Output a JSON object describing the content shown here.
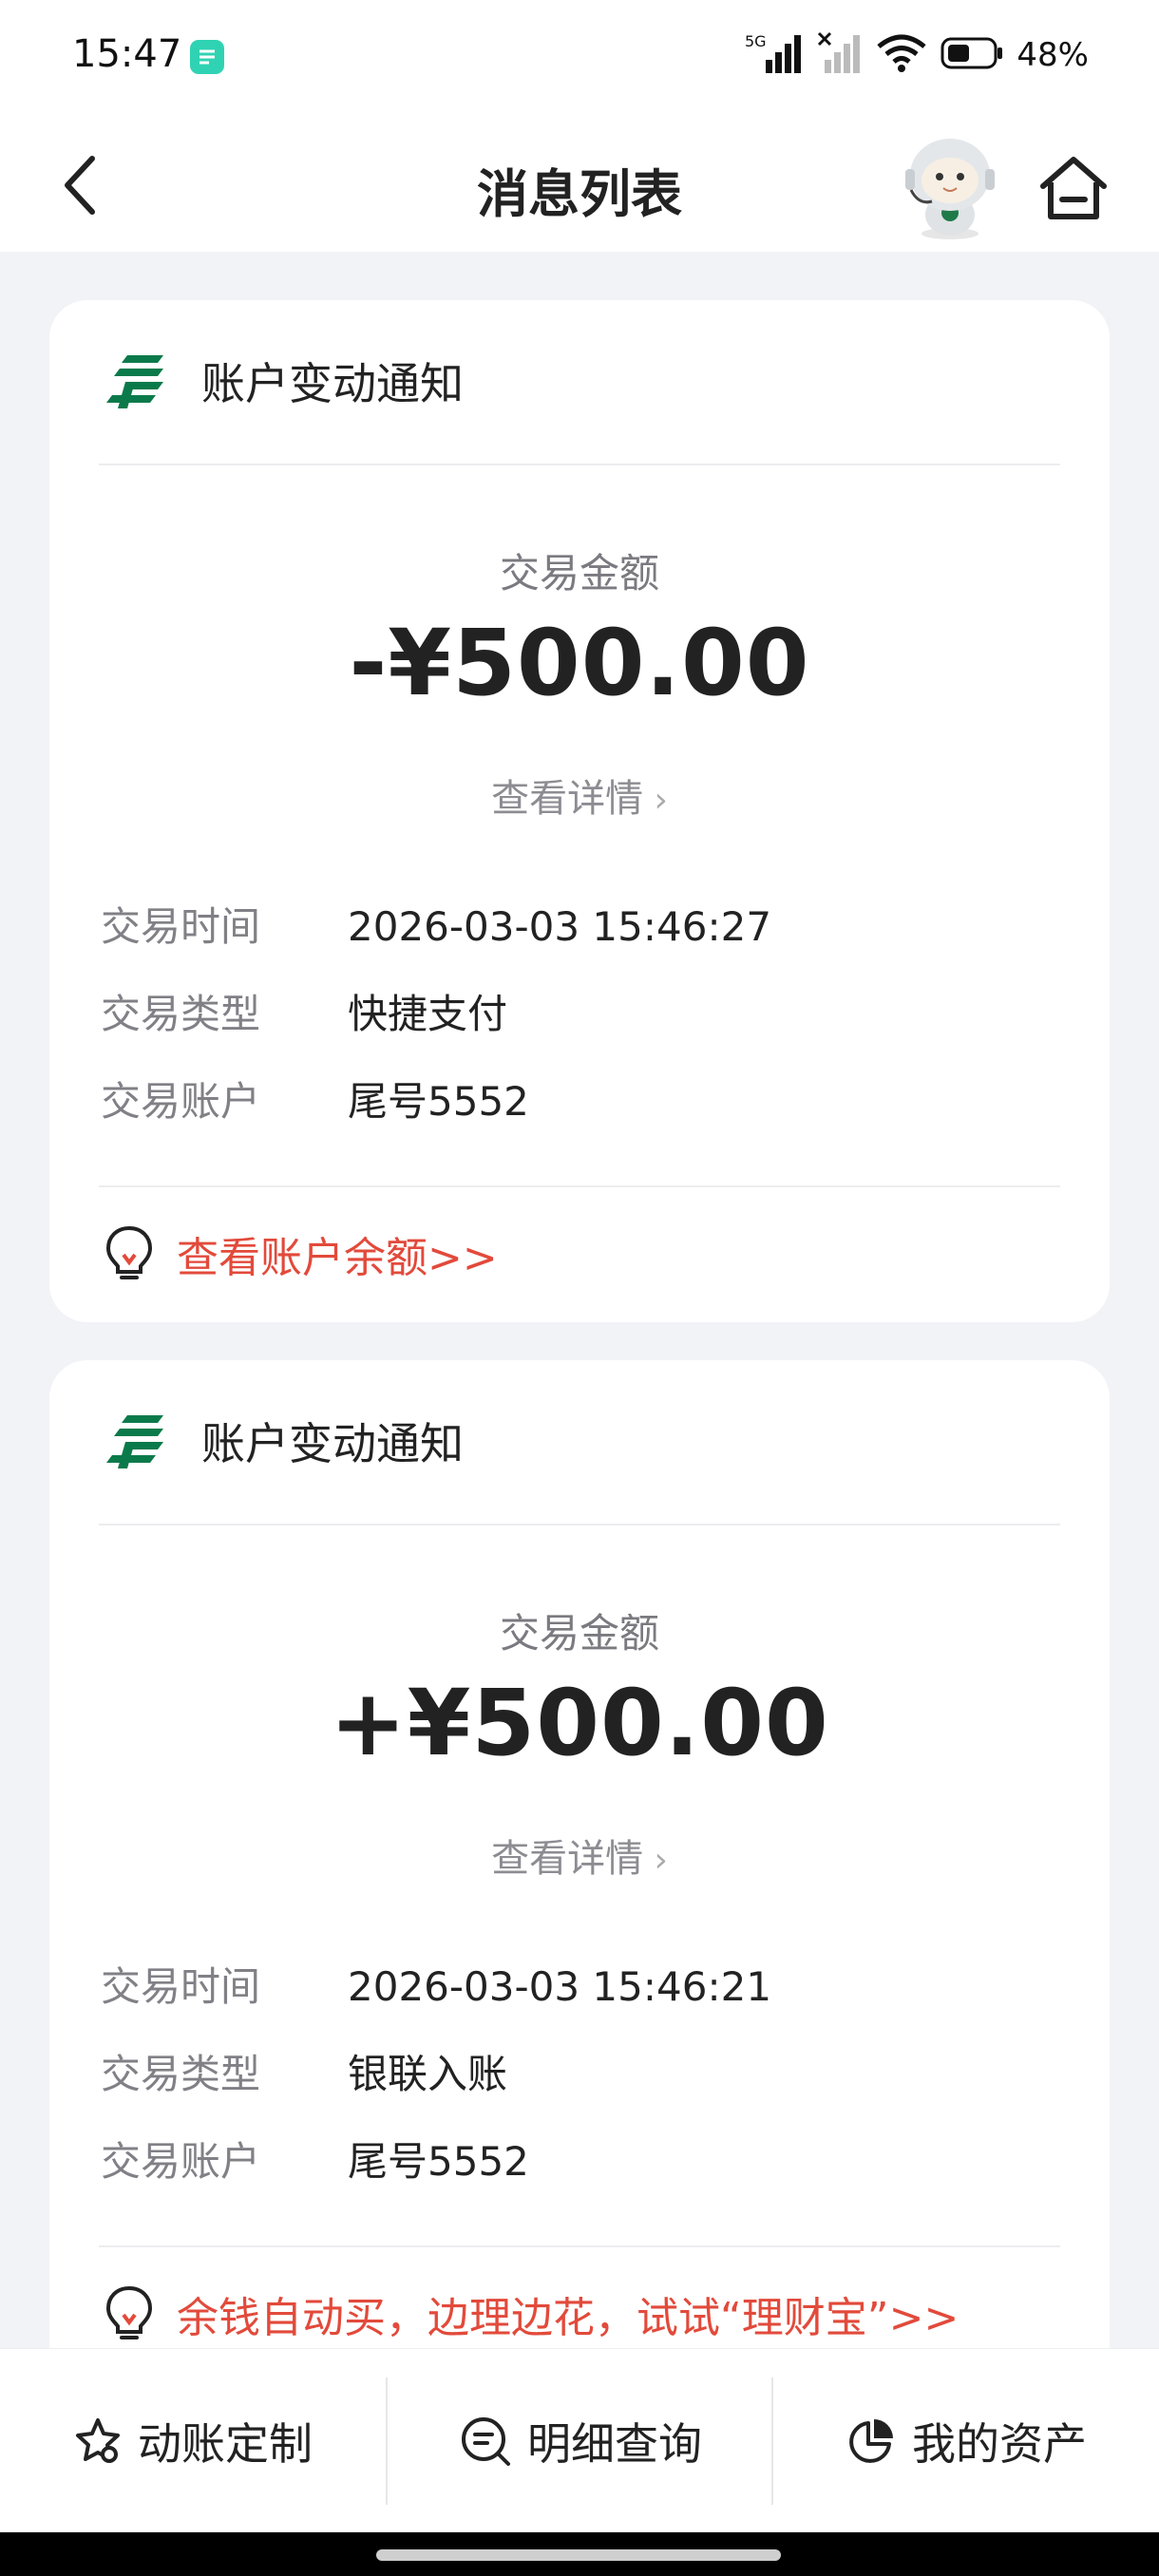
{
  "status_bar": {
    "time": "15:47",
    "network": "5G",
    "battery_percent": "48%",
    "icons": [
      "app-notification-icon",
      "signal-5g-icon",
      "signal-no-service-icon",
      "wifi-icon",
      "battery-icon"
    ]
  },
  "header": {
    "title": "消息列表",
    "back_icon": "chevron-left-icon",
    "home_icon": "home-icon",
    "mascot": "robot-mascot"
  },
  "cards": [
    {
      "title": "账户变动通知",
      "amount_label": "交易金额",
      "amount": "-¥500.00",
      "detail_link": "查看详情",
      "rows": [
        {
          "label": "交易时间",
          "value": "2026-03-03 15:46:27"
        },
        {
          "label": "交易类型",
          "value": "快捷支付"
        },
        {
          "label": "交易账户",
          "value": "尾号5552"
        }
      ],
      "promo": "查看账户余额>>"
    },
    {
      "title": "账户变动通知",
      "amount_label": "交易金额",
      "amount": "+¥500.00",
      "detail_link": "查看详情",
      "rows": [
        {
          "label": "交易时间",
          "value": "2026-03-03 15:46:21"
        },
        {
          "label": "交易类型",
          "value": "银联入账"
        },
        {
          "label": "交易账户",
          "value": "尾号5552"
        }
      ],
      "promo": "余钱自动买，边理边花，试试“理财宝”>>"
    }
  ],
  "bottom_bar": {
    "items": [
      {
        "label": "动账定制",
        "icon": "star-settings-icon"
      },
      {
        "label": "明细查询",
        "icon": "search-list-icon"
      },
      {
        "label": "我的资产",
        "icon": "pie-chart-icon"
      }
    ]
  },
  "colors": {
    "brand_green": "#0b7a4b",
    "promo_red": "#e24a3b",
    "background": "#f2f3f7"
  }
}
